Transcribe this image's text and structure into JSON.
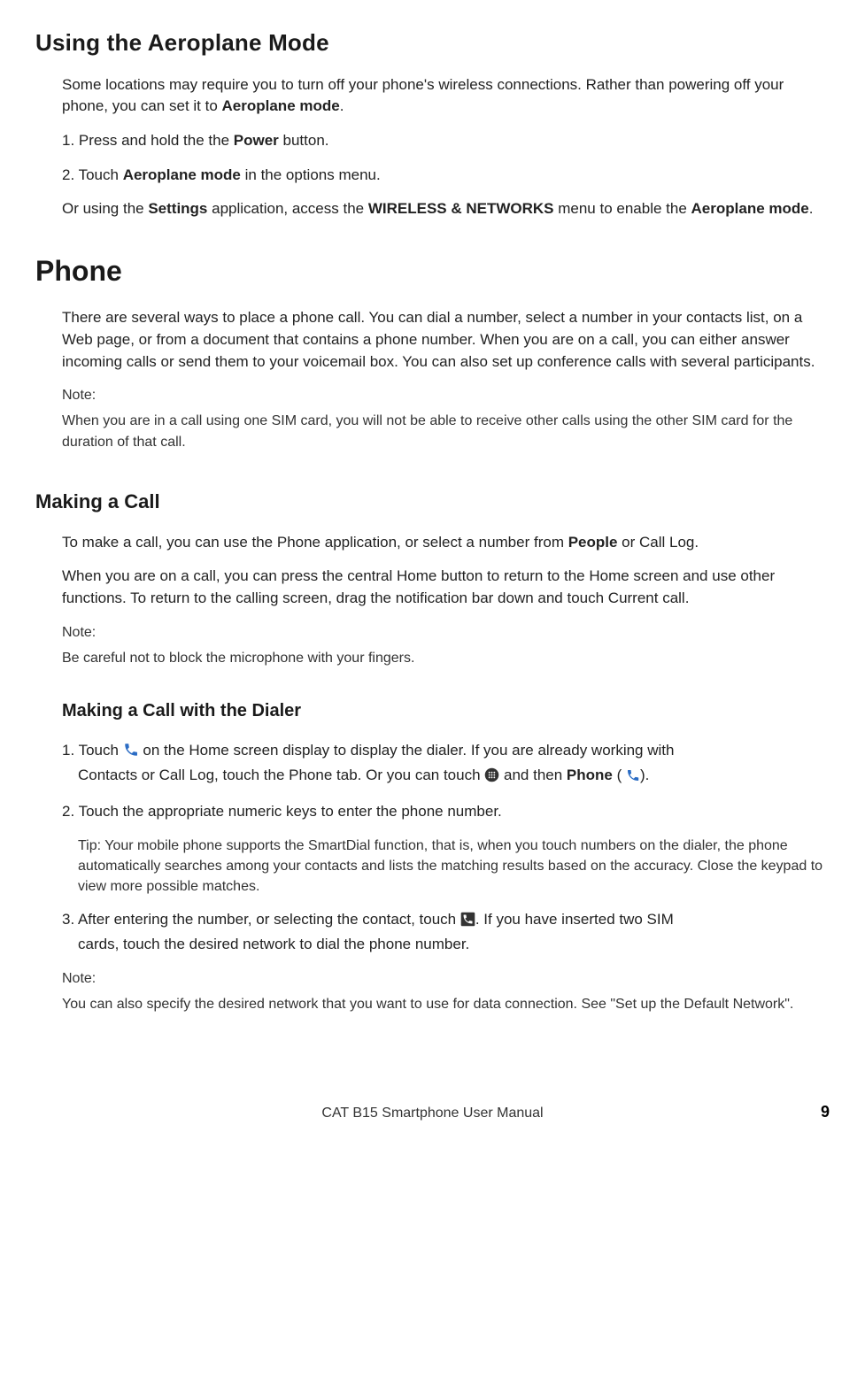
{
  "aeroplane": {
    "title": "Using the Aeroplane Mode",
    "intro_a": "Some locations may require you to turn off your phone's wireless connections. Rather than powering off your phone, you can set it to ",
    "intro_b": "Aeroplane mode",
    "intro_c": ".",
    "step1_a": "1. Press and hold the the ",
    "step1_b": "Power",
    "step1_c": " button.",
    "step2_a": "2. Touch ",
    "step2_b": "Aeroplane mode",
    "step2_c": " in the options menu.",
    "alt_a": "Or using the ",
    "alt_b": "Settings",
    "alt_c": " application, access the ",
    "alt_d": "WIRELESS & NETWORKS",
    "alt_e": " menu to enable the ",
    "alt_f": "Aeroplane mode",
    "alt_g": "."
  },
  "phone": {
    "title": "Phone",
    "intro": "There are several ways to place a phone call. You can dial a number, select a number in your contacts list, on a Web page, or from a document that contains a phone number. When you are on a call, you can either answer incoming calls or send them to your voicemail box. You can also set up conference calls with several participants.",
    "note_label": "Note:",
    "note_body": "When you are in a call using one SIM card, you will not be able to receive other calls using the other SIM card for the duration of that call."
  },
  "making_call": {
    "title": "Making a Call",
    "p1_a": "To make a call, you can use the Phone application, or select a number from ",
    "p1_b": "People",
    "p1_c": " or Call Log.",
    "p2": "When you are on a call, you can press the central Home button to return to the Home screen and use other functions. To return to the calling screen, drag the notification bar down and touch Current call.",
    "note_label": "Note:",
    "note_body": "Be careful not to block the microphone with your fingers."
  },
  "dialer": {
    "title": "Making a Call with the Dialer",
    "s1_a": "1. Touch ",
    "s1_b": " on the Home screen display to display the dialer. If you are already working with",
    "s1_c": "Contacts or Call Log, touch the Phone tab. Or you can touch ",
    "s1_d": " and then ",
    "s1_e": "Phone",
    "s1_f": " (",
    "s1_g": ").",
    "s2": "2. Touch the appropriate numeric keys to enter the phone number.",
    "tip": "Tip: Your mobile phone supports the SmartDial function, that is, when you touch numbers on the dialer, the phone automatically searches among your contacts and lists the matching results based on the accuracy. Close the keypad to view more possible matches.",
    "s3_a": "3. After entering the number, or selecting the contact, touch ",
    "s3_b": ". If you have inserted two SIM",
    "s3_c": "cards, touch the desired network to dial the phone number.",
    "note_label": "Note:",
    "note_body": "You can also specify the desired network that you want to use for data connection. See \"Set up the Default Network\"."
  },
  "footer": {
    "text": "CAT B15 Smartphone User Manual",
    "page": "9"
  }
}
